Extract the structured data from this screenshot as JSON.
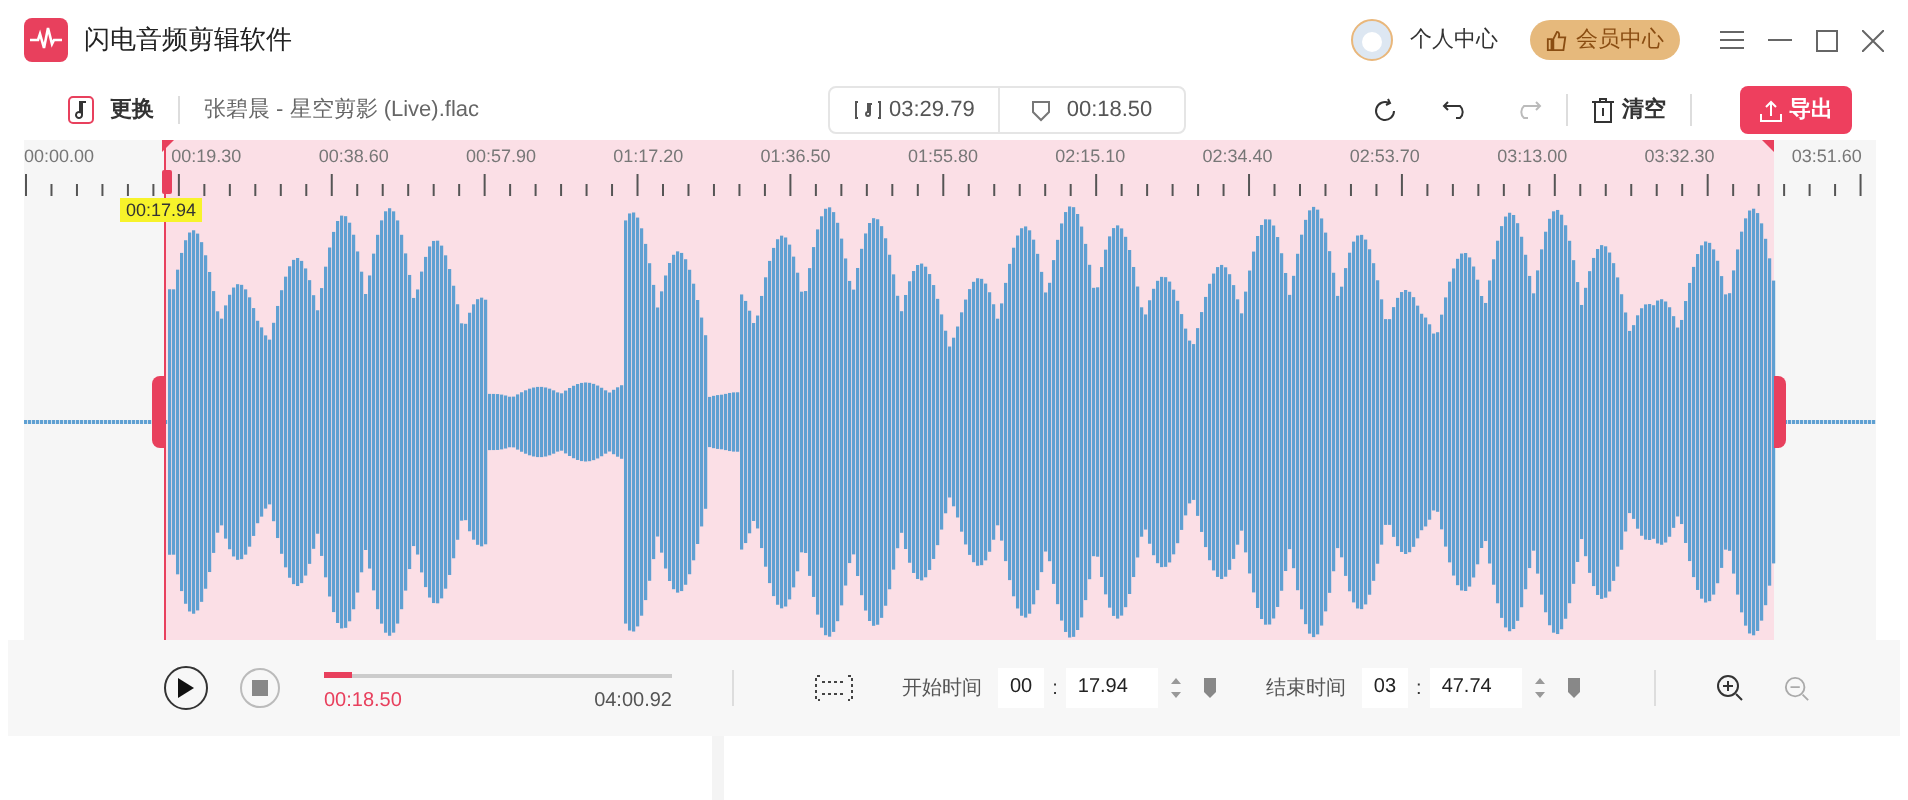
{
  "window": {
    "title": "闪电音频剪辑软件"
  },
  "header": {
    "profile": "个人中心",
    "vip": "会员中心"
  },
  "toolbar": {
    "replace": "更换",
    "file_name": "张碧晨 - 星空剪影 (Live).flac",
    "duration": "03:29.79",
    "selection_length": "00:18.50",
    "clear": "清空",
    "export": "导出"
  },
  "ruler": {
    "labels": [
      "00:00.00",
      "00:19.30",
      "00:38.60",
      "00:57.90",
      "01:17.20",
      "01:36.50",
      "01:55.80",
      "02:15.10",
      "02:34.40",
      "02:53.70",
      "03:13.00",
      "03:32.30",
      "03:51.60"
    ]
  },
  "playhead": {
    "time": "00:17.94"
  },
  "player": {
    "level": 0.08,
    "current": "00:18.50",
    "total": "04:00.92"
  },
  "start": {
    "label": "开始时间",
    "minutes": "00",
    "separator": ":",
    "seconds": "17.94"
  },
  "end": {
    "label": "结束时间",
    "minutes": "03",
    "separator": ":",
    "seconds": "47.74"
  }
}
